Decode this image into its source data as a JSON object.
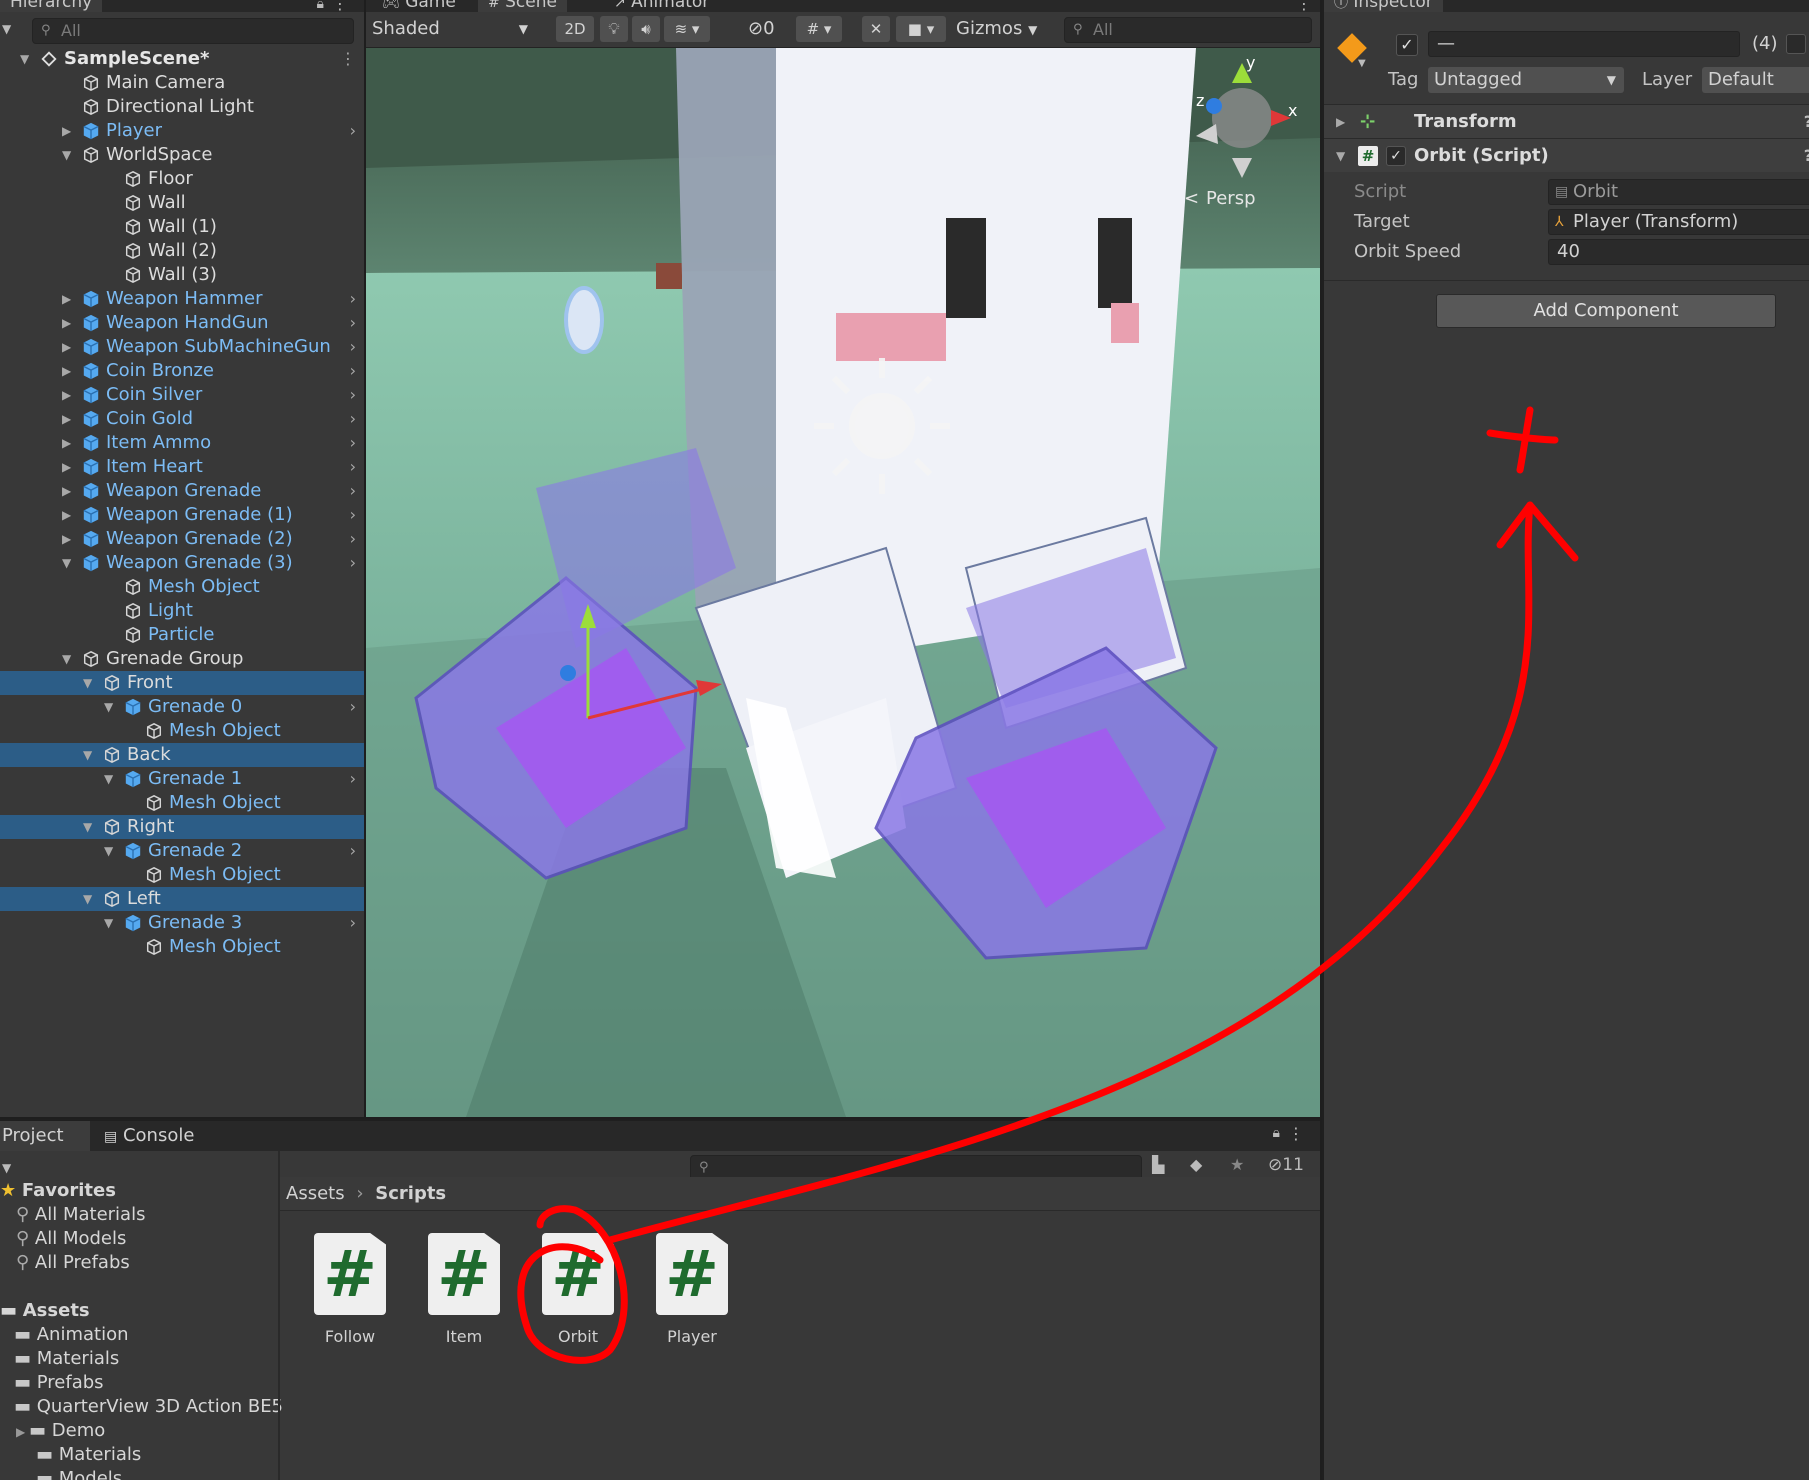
{
  "hierarchy": {
    "tab_label": "Hierarchy",
    "search_placeholder": "All",
    "rows": [
      {
        "label": "SampleScene*",
        "kind": "scene"
      },
      {
        "label": "Main Camera",
        "kind": "go"
      },
      {
        "label": "Directional Light",
        "kind": "go"
      },
      {
        "label": "Player",
        "kind": "prefab"
      },
      {
        "label": "WorldSpace",
        "kind": "go"
      },
      {
        "label": "Floor",
        "kind": "go"
      },
      {
        "label": "Wall",
        "kind": "go"
      },
      {
        "label": "Wall (1)",
        "kind": "go"
      },
      {
        "label": "Wall (2)",
        "kind": "go"
      },
      {
        "label": "Wall (3)",
        "kind": "go"
      },
      {
        "label": "Weapon Hammer",
        "kind": "prefab"
      },
      {
        "label": "Weapon HandGun",
        "kind": "prefab"
      },
      {
        "label": "Weapon SubMachineGun",
        "kind": "prefab"
      },
      {
        "label": "Coin Bronze",
        "kind": "prefab"
      },
      {
        "label": "Coin Silver",
        "kind": "prefab"
      },
      {
        "label": "Coin Gold",
        "kind": "prefab"
      },
      {
        "label": "Item Ammo",
        "kind": "prefab"
      },
      {
        "label": "Item Heart",
        "kind": "prefab"
      },
      {
        "label": "Weapon Grenade",
        "kind": "prefab"
      },
      {
        "label": "Weapon Grenade (1)",
        "kind": "prefab"
      },
      {
        "label": "Weapon Grenade (2)",
        "kind": "prefab"
      },
      {
        "label": "Weapon Grenade (3)",
        "kind": "prefab"
      },
      {
        "label": "Mesh Object",
        "kind": "prefab-child"
      },
      {
        "label": "Light",
        "kind": "prefab-child"
      },
      {
        "label": "Particle",
        "kind": "prefab-child"
      },
      {
        "label": "Grenade Group",
        "kind": "go"
      },
      {
        "label": "Front",
        "kind": "go-selected"
      },
      {
        "label": "Grenade 0",
        "kind": "prefab"
      },
      {
        "label": "Mesh Object",
        "kind": "prefab-child"
      },
      {
        "label": "Back",
        "kind": "go-selected"
      },
      {
        "label": "Grenade 1",
        "kind": "prefab"
      },
      {
        "label": "Mesh Object",
        "kind": "prefab-child"
      },
      {
        "label": "Right",
        "kind": "go-selected"
      },
      {
        "label": "Grenade 2",
        "kind": "prefab"
      },
      {
        "label": "Mesh Object",
        "kind": "prefab-child"
      },
      {
        "label": "Left",
        "kind": "go-selected"
      },
      {
        "label": "Grenade 3",
        "kind": "prefab"
      },
      {
        "label": "Mesh Object",
        "kind": "prefab-child"
      }
    ]
  },
  "scene": {
    "tabs": [
      "Game",
      "Scene",
      "Animator"
    ],
    "shading_mode": "Shaded",
    "mode_2d": "2D",
    "hidden_count": "0",
    "gizmos_label": "Gizmos",
    "search_placeholder": "All",
    "persp_label": "Persp",
    "axis_y": "y",
    "axis_x": "x",
    "axis_z": "z"
  },
  "inspector": {
    "tab_label": "Inspector",
    "name_value": "—",
    "multi_count": "(4)",
    "tag_label": "Tag",
    "tag_value": "Untagged",
    "layer_label": "Layer",
    "layer_value": "Default",
    "transform_label": "Transform",
    "orbit_label": "Orbit (Script)",
    "props": [
      {
        "label": "Script",
        "value": "Orbit"
      },
      {
        "label": "Target",
        "value": "Player (Transform)"
      },
      {
        "label": "Orbit Speed",
        "value": "40"
      }
    ],
    "add_component": "Add Component"
  },
  "project": {
    "tabs": [
      "Project",
      "Console"
    ],
    "hidden_count": "11",
    "favorites_label": "Favorites",
    "favorites": [
      "All Materials",
      "All Models",
      "All Prefabs"
    ],
    "assets_label": "Assets",
    "asset_folders": [
      "Animation",
      "Materials",
      "Prefabs",
      "QuarterView 3D Action BE5"
    ],
    "sub_folders": [
      "Demo",
      "Materials",
      "Models"
    ],
    "breadcrumb": [
      "Assets",
      "Scripts"
    ],
    "scripts": [
      "Follow",
      "Item",
      "Orbit",
      "Player"
    ]
  },
  "colors": {
    "selection": "#2c5d87",
    "prefab_text": "#7cbcf5",
    "annotation": "#ff0000",
    "script_hash": "#1f6b2e"
  }
}
